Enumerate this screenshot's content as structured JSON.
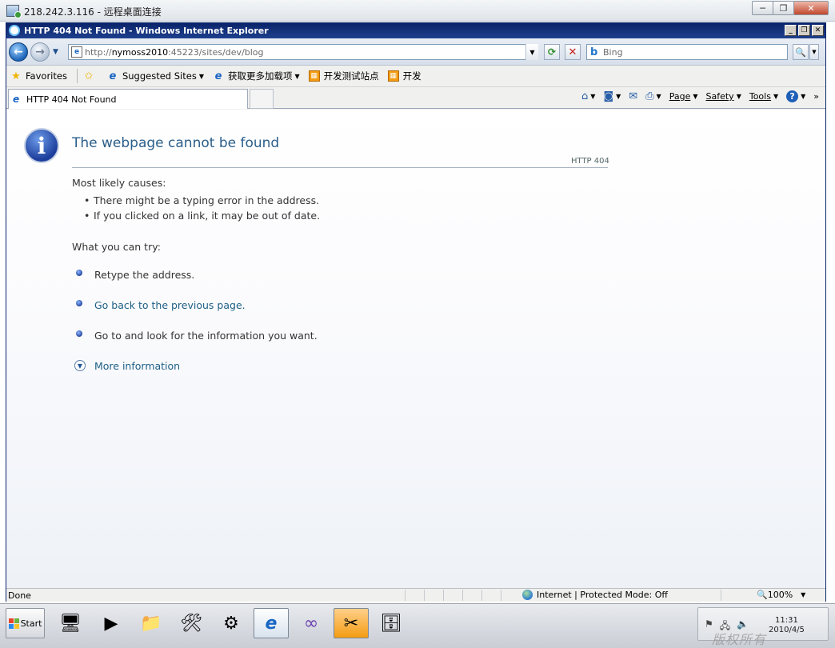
{
  "rdp": {
    "title": "218.242.3.116 - 远程桌面连接"
  },
  "ie": {
    "title": "HTTP 404 Not Found - Windows Internet Explorer",
    "address": {
      "protocol": "http://",
      "host": "nymoss2010",
      "rest": ":45223/sites/dev/blog"
    },
    "search_placeholder": "Bing",
    "favorites_bar": {
      "favorites_label": "Favorites",
      "items": [
        {
          "label": "Suggested Sites",
          "icon": "ie-icon",
          "has_dropdown": true
        },
        {
          "label": "获取更多加载项",
          "icon": "ie-icon",
          "has_dropdown": true
        },
        {
          "label": "开发测试站点",
          "icon": "orange-site-icon",
          "has_dropdown": false
        },
        {
          "label": "开发",
          "icon": "orange-site-icon",
          "has_dropdown": false
        }
      ]
    },
    "tab": {
      "label": "HTTP 404 Not Found"
    },
    "command_bar": {
      "page": "Page",
      "safety": "Safety",
      "tools": "Tools"
    },
    "status": {
      "text": "Done",
      "zone": "Internet | Protected Mode: Off",
      "zoom": "100%"
    }
  },
  "page": {
    "title": "The webpage cannot be found",
    "code": "HTTP 404",
    "causes_heading": "Most likely causes:",
    "causes": [
      "There might be a typing error in the address.",
      "If you clicked on a link, it may be out of date."
    ],
    "try_heading": "What you can try:",
    "try_items": [
      {
        "text": "Retype the address.",
        "link": false
      },
      {
        "text": "Go back to the previous page.",
        "link": true
      },
      {
        "text": "Go to  and look for the information you want.",
        "link": false
      }
    ],
    "more_info": "More information"
  },
  "taskbar": {
    "start_label": "Start",
    "clock_time": "11:31",
    "clock_date": "2010/4/5"
  },
  "watermark": "版权所有@yuvy.com"
}
